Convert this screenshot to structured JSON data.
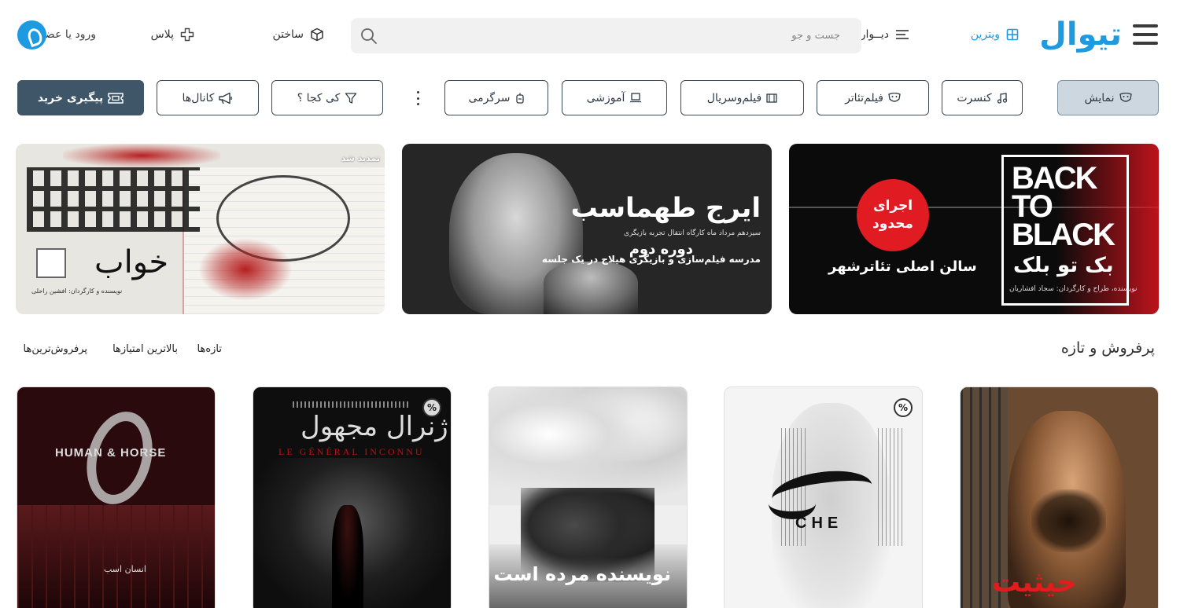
{
  "header": {
    "logo": "تیوال",
    "nav_vitrin": "ویترین",
    "nav_divar": "دیــوار",
    "search_placeholder": "جست و جو",
    "nav_build": "ساختن",
    "nav_plus": "پلاس",
    "nav_login": "ورود یا عضویت",
    "accent_color": "#1e9be0"
  },
  "chips": {
    "show": "نمایش",
    "concert": "کنسرت",
    "film_theater": "فیلم‌تئاتر",
    "film_series": "فیلم‌وسریال",
    "education": "آموزشی",
    "entertainment": "سرگرمی",
    "where_when": "کی کجا ؟",
    "channels": "کانال‌ها",
    "track_purchase": "پیگیری خرید"
  },
  "banners": [
    {
      "title_en": "BACK TO BLACK",
      "title_fa": "بک تو بلک",
      "badge": "اجرای محدود",
      "venue": "سالن اصلی تئاترشهر",
      "credit": "نویسنده، طراح و کارگردان: سجاد افشاریان"
    },
    {
      "name": "ایرج طهماسب",
      "info": "سیزدهم مرداد ماه  کارگاه انتقال تجربه بازیگری",
      "term": "دوره دوم",
      "session": "مدرسه فیلم‌سازی و بازیگری هیلاج در یک جلسه"
    },
    {
      "extended_label": "تمدید شد",
      "script_title": "خواب",
      "credit": "نویسنده و کارگردان: افشین  راحلی"
    }
  ],
  "section": {
    "title": "پرفروش و تازه",
    "sort_tabs": [
      "تازه‌ها",
      "بالاترین امتیازها",
      "پرفروش‌ترین‌ها"
    ]
  },
  "posters": [
    {
      "title": "حیثیت",
      "discount": ""
    },
    {
      "title": "CHE",
      "discount": "%"
    },
    {
      "title": "نویسنده مرده است",
      "discount": ""
    },
    {
      "title": "ژنرال مجهول",
      "subtitle": "LE GÉNÉRAL INCONNU",
      "discount": "%"
    },
    {
      "title": "HUMAN & HORSE",
      "subtitle_fa": "انسان اسب",
      "discount": ""
    }
  ]
}
